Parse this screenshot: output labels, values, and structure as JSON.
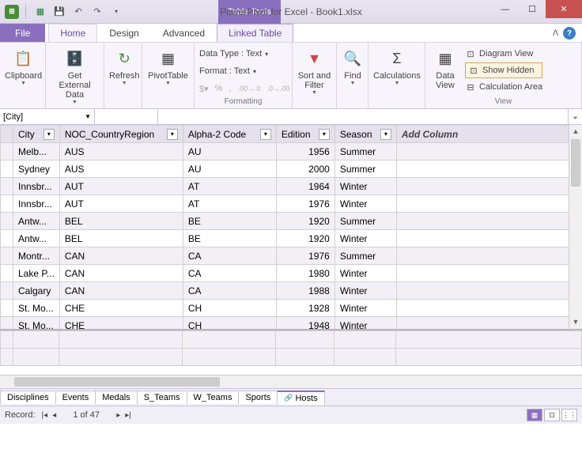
{
  "window": {
    "context_tab": "Table Tools",
    "title": "PowerPivot for Excel - Book1.xlsx"
  },
  "ribbon_tabs": {
    "file": "File",
    "home": "Home",
    "design": "Design",
    "advanced": "Advanced",
    "linked": "Linked Table"
  },
  "ribbon": {
    "clipboard": "Clipboard",
    "get_data": "Get External\nData",
    "refresh": "Refresh",
    "pivot": "PivotTable",
    "data_type": "Data Type : Text",
    "format": "Format : Text",
    "formatting_label": "Formatting",
    "sort_filter": "Sort and\nFilter",
    "find": "Find",
    "calculations": "Calculations",
    "data_view": "Data\nView",
    "diagram_view": "Diagram View",
    "show_hidden": "Show Hidden",
    "calc_area": "Calculation Area",
    "view_label": "View"
  },
  "formula_bar": {
    "name": "[City]"
  },
  "grid": {
    "columns": [
      "City",
      "NOC_CountryRegion",
      "Alpha-2 Code",
      "Edition",
      "Season"
    ],
    "add_column": "Add Column",
    "rows": [
      {
        "city": "Melb...",
        "noc": "AUS",
        "a2": "AU",
        "ed": 1956,
        "season": "Summer"
      },
      {
        "city": "Sydney",
        "noc": "AUS",
        "a2": "AU",
        "ed": 2000,
        "season": "Summer"
      },
      {
        "city": "Innsbr...",
        "noc": "AUT",
        "a2": "AT",
        "ed": 1964,
        "season": "Winter"
      },
      {
        "city": "Innsbr...",
        "noc": "AUT",
        "a2": "AT",
        "ed": 1976,
        "season": "Winter"
      },
      {
        "city": "Antw...",
        "noc": "BEL",
        "a2": "BE",
        "ed": 1920,
        "season": "Summer"
      },
      {
        "city": "Antw...",
        "noc": "BEL",
        "a2": "BE",
        "ed": 1920,
        "season": "Winter"
      },
      {
        "city": "Montr...",
        "noc": "CAN",
        "a2": "CA",
        "ed": 1976,
        "season": "Summer"
      },
      {
        "city": "Lake P...",
        "noc": "CAN",
        "a2": "CA",
        "ed": 1980,
        "season": "Winter"
      },
      {
        "city": "Calgary",
        "noc": "CAN",
        "a2": "CA",
        "ed": 1988,
        "season": "Winter"
      },
      {
        "city": "St. Mo...",
        "noc": "CHE",
        "a2": "CH",
        "ed": 1928,
        "season": "Winter"
      },
      {
        "city": "St. Mo...",
        "noc": "CHE",
        "a2": "CH",
        "ed": 1948,
        "season": "Winter"
      }
    ]
  },
  "sheet_tabs": [
    "Disciplines",
    "Events",
    "Medals",
    "S_Teams",
    "W_Teams",
    "Sports",
    "Hosts"
  ],
  "status": {
    "record_label": "Record:",
    "position": "1 of 47"
  }
}
